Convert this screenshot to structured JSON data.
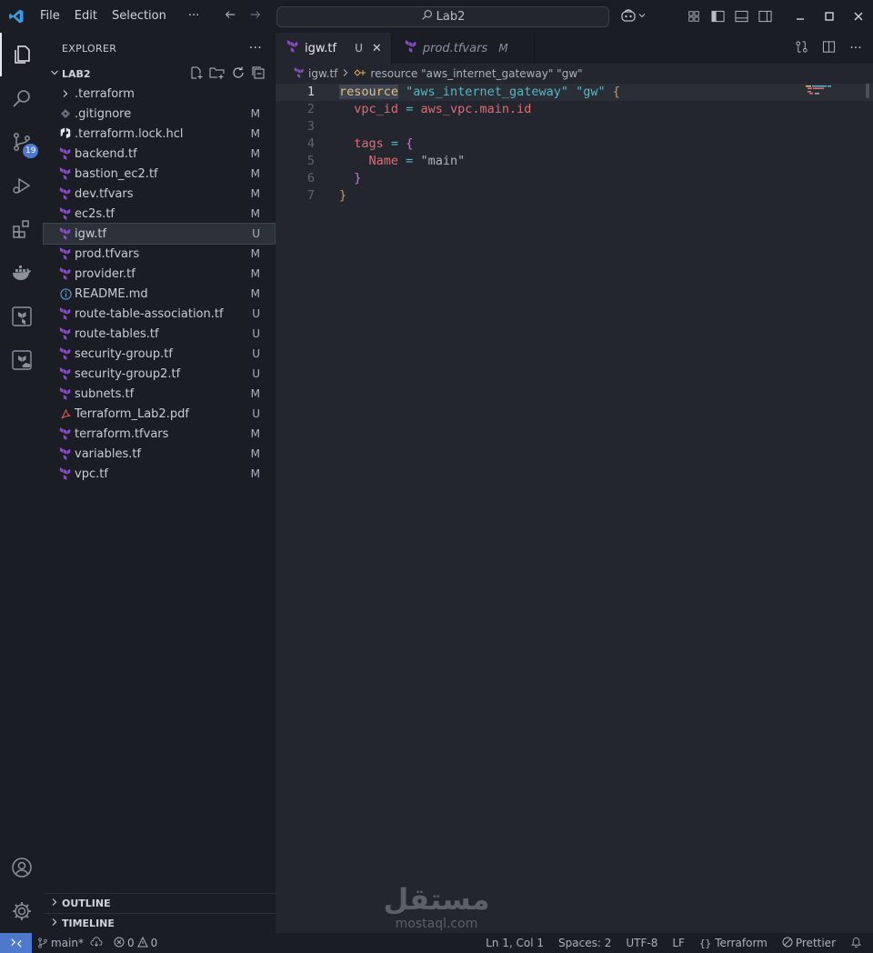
{
  "titlebar": {
    "menu": [
      "File",
      "Edit",
      "Selection"
    ],
    "more": "···",
    "search_text": "Lab2"
  },
  "activity": {
    "scm_badge": "19"
  },
  "explorer": {
    "title": "EXPLORER",
    "more": "···",
    "folder": "LAB2",
    "items": [
      {
        "name": ".terraform",
        "type": "folder",
        "status": ""
      },
      {
        "name": ".gitignore",
        "type": "git",
        "status": "M"
      },
      {
        "name": ".terraform.lock.hcl",
        "type": "hcl",
        "status": "M"
      },
      {
        "name": "backend.tf",
        "type": "tf",
        "status": "M"
      },
      {
        "name": "bastion_ec2.tf",
        "type": "tf",
        "status": "M"
      },
      {
        "name": "dev.tfvars",
        "type": "tf",
        "status": "M"
      },
      {
        "name": "ec2s.tf",
        "type": "tf",
        "status": "M"
      },
      {
        "name": "igw.tf",
        "type": "tf",
        "status": "U"
      },
      {
        "name": "prod.tfvars",
        "type": "tf",
        "status": "M"
      },
      {
        "name": "provider.tf",
        "type": "tf",
        "status": "M"
      },
      {
        "name": "README.md",
        "type": "info",
        "status": "M"
      },
      {
        "name": "route-table-association.tf",
        "type": "tf",
        "status": "U"
      },
      {
        "name": "route-tables.tf",
        "type": "tf",
        "status": "U"
      },
      {
        "name": "security-group.tf",
        "type": "tf",
        "status": "U"
      },
      {
        "name": "security-group2.tf",
        "type": "tf",
        "status": "U"
      },
      {
        "name": "subnets.tf",
        "type": "tf",
        "status": "M"
      },
      {
        "name": "Terraform_Lab2.pdf",
        "type": "pdf",
        "status": "U"
      },
      {
        "name": "terraform.tfvars",
        "type": "tf",
        "status": "M"
      },
      {
        "name": "variables.tf",
        "type": "tf",
        "status": "M"
      },
      {
        "name": "vpc.tf",
        "type": "tf",
        "status": "M"
      }
    ],
    "outline": "OUTLINE",
    "timeline": "TIMELINE"
  },
  "tabs": [
    {
      "name": "igw.tf",
      "status": "U",
      "close": "✕"
    },
    {
      "name": "prod.tfvars",
      "status": "M"
    }
  ],
  "breadcrumb": {
    "file": "igw.tf",
    "symbol": "resource \"aws_internet_gateway\" \"gw\""
  },
  "code": {
    "line_numbers": [
      "1",
      "2",
      "3",
      "4",
      "5",
      "6",
      "7"
    ],
    "l1_kw": "resource",
    "l1_s1": "\"aws_internet_gateway\"",
    "l1_s2": "\"gw\"",
    "l1_brace": "{",
    "l2_prop": "vpc_id",
    "l2_eq": "=",
    "l2_val": "aws_vpc.main.id",
    "l4_prop": "tags",
    "l4_eq": "=",
    "l4_brace": "{",
    "l5_prop": "Name",
    "l5_eq": "=",
    "l5_val": "\"main\"",
    "l6_brace": "}",
    "l7_brace": "}"
  },
  "statusbar": {
    "branch": "main*",
    "errors": "0",
    "warnings": "0",
    "position": "Ln 1, Col 1",
    "spaces": "Spaces: 2",
    "encoding": "UTF-8",
    "eol": "LF",
    "language": "Terraform",
    "formatter": "Prettier"
  },
  "watermark": {
    "arabic": "مستقل",
    "latin": "mostaql.com"
  },
  "colors": {
    "accent": "#4d78cc",
    "terraform_purple": "#844fba",
    "pdf_red": "#d9534f",
    "info_blue": "#5b9bd5"
  }
}
